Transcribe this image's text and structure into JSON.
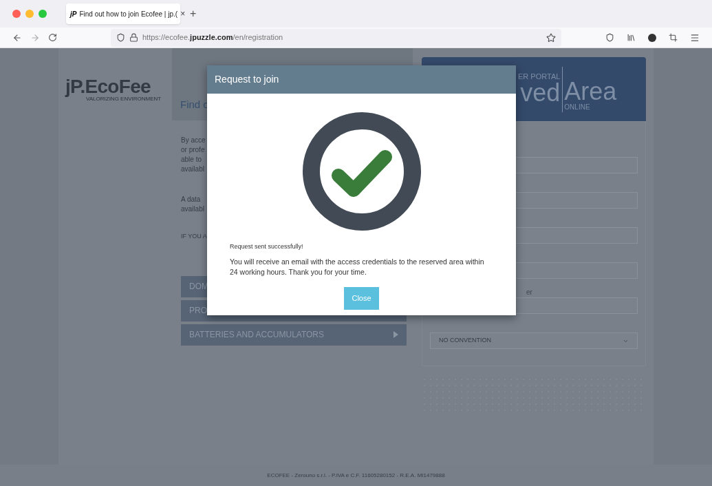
{
  "browser": {
    "tab": {
      "favicon": "jP",
      "title": "Find out how to join Ecofee | jp.(",
      "close": "×",
      "selected": true
    },
    "new_tab": "+",
    "url": "https://ecofee.**jpuzzle.com**/en/registration"
  },
  "page": {
    "logo": {
      "text": "jP.EcoFee",
      "tagline": "VALORIZING ENVIRONMENT"
    },
    "heading": "Find c",
    "paragraphs": [
      [
        "By acce",
        "or profe",
        "able to",
        "availabl"
      ],
      [
        "A data",
        "availabl"
      ]
    ],
    "notice": "IF YOU A",
    "categories": [
      {
        "label": "DOM",
        "arrow": false
      },
      {
        "label": "PRO",
        "arrow": false
      },
      {
        "label": "BATTERIES AND ACCUMULATORS",
        "arrow": true
      }
    ],
    "portal": {
      "subtitle": "ER PORTAL",
      "word_1": "ved",
      "word_2": "Area",
      "tag": "ONLINE"
    },
    "form": {
      "fields": [
        {
          "kind": "input"
        },
        {
          "kind": "input"
        },
        {
          "kind": "input"
        },
        {
          "kind": "input"
        },
        {
          "kind": "input",
          "label": "er"
        },
        {
          "kind": "select",
          "value": "NO CONVENTION"
        }
      ]
    },
    "footer": "ECOFEE - Zerouno s.r.l. - P.IVA e C.F. 11605280152 - R.E.A. MI1479888"
  },
  "modal": {
    "title": "Request to join",
    "message_title": "Request sent successfully!",
    "message": "You will receive an email with the access credentials to the reserved area within 24 working hours. Thank you for your time.",
    "button": "Close"
  }
}
